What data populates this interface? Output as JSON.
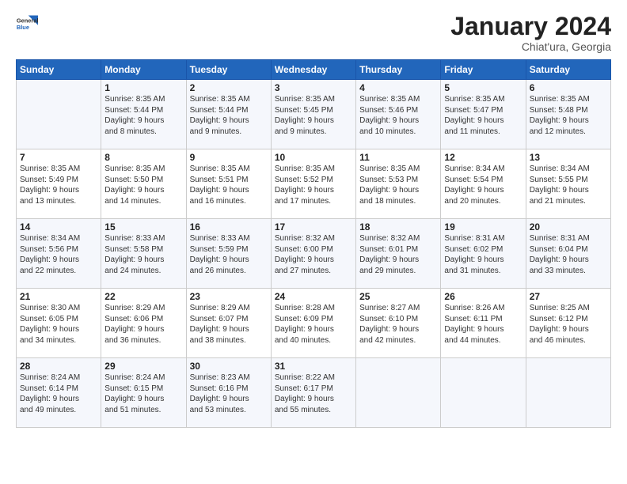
{
  "logo": {
    "general": "General",
    "blue": "Blue"
  },
  "header": {
    "month": "January 2024",
    "location": "Chiat'ura, Georgia"
  },
  "weekdays": [
    "Sunday",
    "Monday",
    "Tuesday",
    "Wednesday",
    "Thursday",
    "Friday",
    "Saturday"
  ],
  "weeks": [
    [
      {
        "day": "",
        "info": ""
      },
      {
        "day": "1",
        "info": "Sunrise: 8:35 AM\nSunset: 5:44 PM\nDaylight: 9 hours\nand 8 minutes."
      },
      {
        "day": "2",
        "info": "Sunrise: 8:35 AM\nSunset: 5:44 PM\nDaylight: 9 hours\nand 9 minutes."
      },
      {
        "day": "3",
        "info": "Sunrise: 8:35 AM\nSunset: 5:45 PM\nDaylight: 9 hours\nand 9 minutes."
      },
      {
        "day": "4",
        "info": "Sunrise: 8:35 AM\nSunset: 5:46 PM\nDaylight: 9 hours\nand 10 minutes."
      },
      {
        "day": "5",
        "info": "Sunrise: 8:35 AM\nSunset: 5:47 PM\nDaylight: 9 hours\nand 11 minutes."
      },
      {
        "day": "6",
        "info": "Sunrise: 8:35 AM\nSunset: 5:48 PM\nDaylight: 9 hours\nand 12 minutes."
      }
    ],
    [
      {
        "day": "7",
        "info": "Sunrise: 8:35 AM\nSunset: 5:49 PM\nDaylight: 9 hours\nand 13 minutes."
      },
      {
        "day": "8",
        "info": "Sunrise: 8:35 AM\nSunset: 5:50 PM\nDaylight: 9 hours\nand 14 minutes."
      },
      {
        "day": "9",
        "info": "Sunrise: 8:35 AM\nSunset: 5:51 PM\nDaylight: 9 hours\nand 16 minutes."
      },
      {
        "day": "10",
        "info": "Sunrise: 8:35 AM\nSunset: 5:52 PM\nDaylight: 9 hours\nand 17 minutes."
      },
      {
        "day": "11",
        "info": "Sunrise: 8:35 AM\nSunset: 5:53 PM\nDaylight: 9 hours\nand 18 minutes."
      },
      {
        "day": "12",
        "info": "Sunrise: 8:34 AM\nSunset: 5:54 PM\nDaylight: 9 hours\nand 20 minutes."
      },
      {
        "day": "13",
        "info": "Sunrise: 8:34 AM\nSunset: 5:55 PM\nDaylight: 9 hours\nand 21 minutes."
      }
    ],
    [
      {
        "day": "14",
        "info": "Sunrise: 8:34 AM\nSunset: 5:56 PM\nDaylight: 9 hours\nand 22 minutes."
      },
      {
        "day": "15",
        "info": "Sunrise: 8:33 AM\nSunset: 5:58 PM\nDaylight: 9 hours\nand 24 minutes."
      },
      {
        "day": "16",
        "info": "Sunrise: 8:33 AM\nSunset: 5:59 PM\nDaylight: 9 hours\nand 26 minutes."
      },
      {
        "day": "17",
        "info": "Sunrise: 8:32 AM\nSunset: 6:00 PM\nDaylight: 9 hours\nand 27 minutes."
      },
      {
        "day": "18",
        "info": "Sunrise: 8:32 AM\nSunset: 6:01 PM\nDaylight: 9 hours\nand 29 minutes."
      },
      {
        "day": "19",
        "info": "Sunrise: 8:31 AM\nSunset: 6:02 PM\nDaylight: 9 hours\nand 31 minutes."
      },
      {
        "day": "20",
        "info": "Sunrise: 8:31 AM\nSunset: 6:04 PM\nDaylight: 9 hours\nand 33 minutes."
      }
    ],
    [
      {
        "day": "21",
        "info": "Sunrise: 8:30 AM\nSunset: 6:05 PM\nDaylight: 9 hours\nand 34 minutes."
      },
      {
        "day": "22",
        "info": "Sunrise: 8:29 AM\nSunset: 6:06 PM\nDaylight: 9 hours\nand 36 minutes."
      },
      {
        "day": "23",
        "info": "Sunrise: 8:29 AM\nSunset: 6:07 PM\nDaylight: 9 hours\nand 38 minutes."
      },
      {
        "day": "24",
        "info": "Sunrise: 8:28 AM\nSunset: 6:09 PM\nDaylight: 9 hours\nand 40 minutes."
      },
      {
        "day": "25",
        "info": "Sunrise: 8:27 AM\nSunset: 6:10 PM\nDaylight: 9 hours\nand 42 minutes."
      },
      {
        "day": "26",
        "info": "Sunrise: 8:26 AM\nSunset: 6:11 PM\nDaylight: 9 hours\nand 44 minutes."
      },
      {
        "day": "27",
        "info": "Sunrise: 8:25 AM\nSunset: 6:12 PM\nDaylight: 9 hours\nand 46 minutes."
      }
    ],
    [
      {
        "day": "28",
        "info": "Sunrise: 8:24 AM\nSunset: 6:14 PM\nDaylight: 9 hours\nand 49 minutes."
      },
      {
        "day": "29",
        "info": "Sunrise: 8:24 AM\nSunset: 6:15 PM\nDaylight: 9 hours\nand 51 minutes."
      },
      {
        "day": "30",
        "info": "Sunrise: 8:23 AM\nSunset: 6:16 PM\nDaylight: 9 hours\nand 53 minutes."
      },
      {
        "day": "31",
        "info": "Sunrise: 8:22 AM\nSunset: 6:17 PM\nDaylight: 9 hours\nand 55 minutes."
      },
      {
        "day": "",
        "info": ""
      },
      {
        "day": "",
        "info": ""
      },
      {
        "day": "",
        "info": ""
      }
    ]
  ]
}
